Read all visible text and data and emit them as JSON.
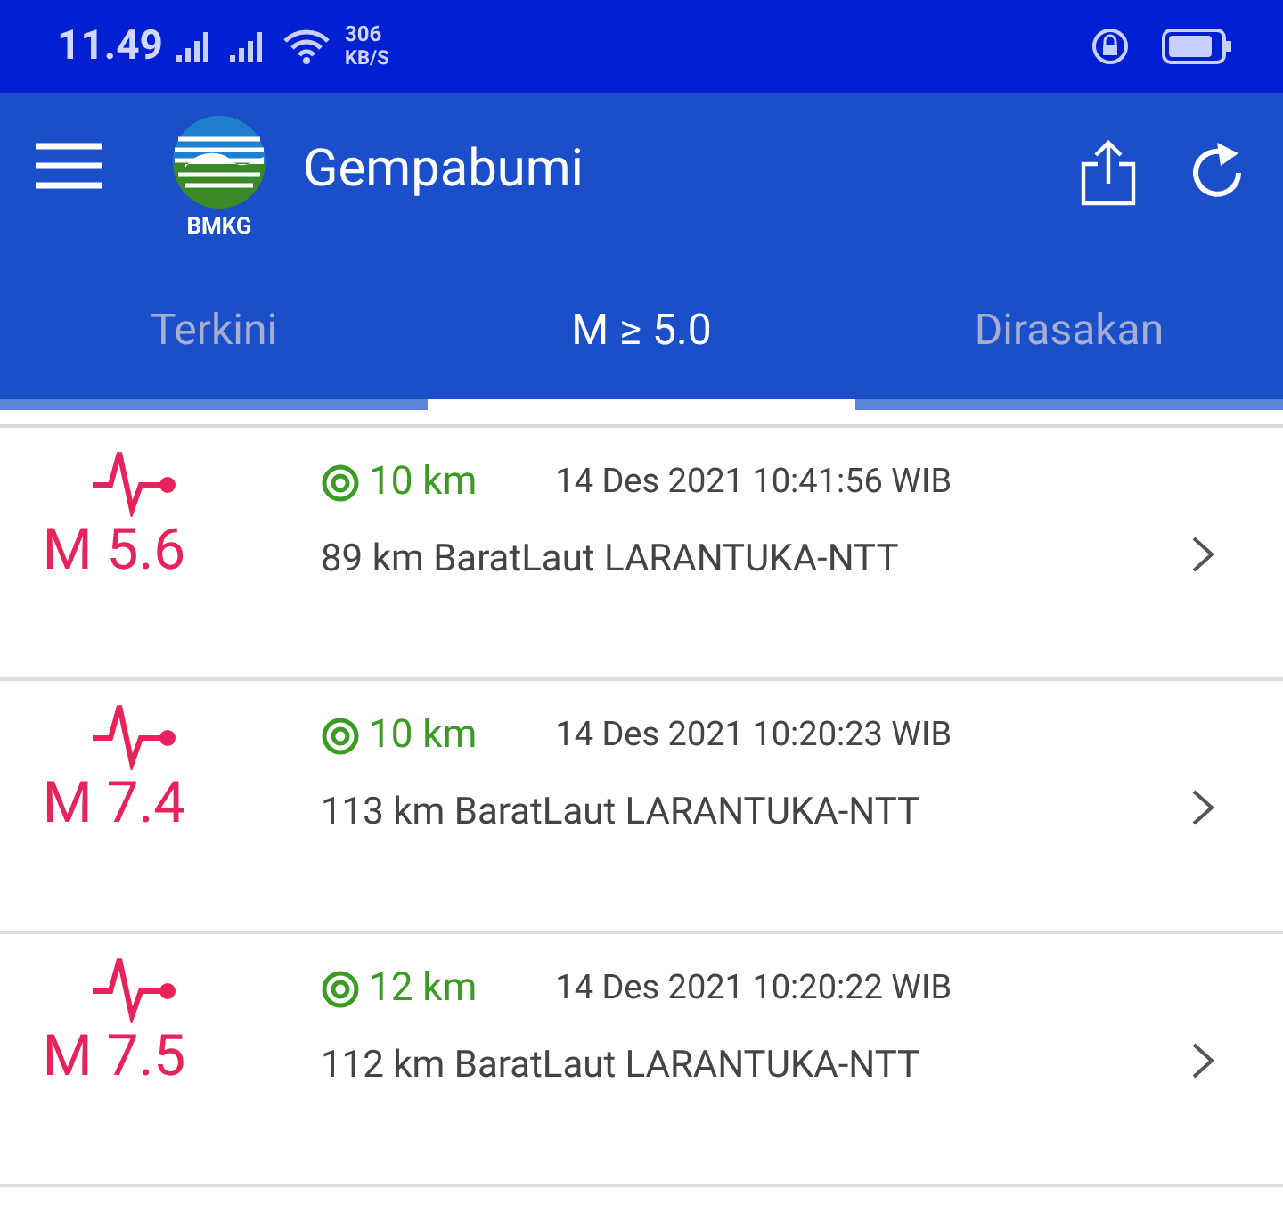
{
  "status_bar": {
    "time": "11.49",
    "speed_value": "306",
    "speed_unit": "KB/S"
  },
  "app_bar": {
    "logo_text": "BMKG",
    "title": "Gempabumi"
  },
  "tabs": [
    {
      "label": "Terkini",
      "selected": false
    },
    {
      "label": "M ≥ 5.0",
      "selected": true
    },
    {
      "label": "Dirasakan",
      "selected": false
    }
  ],
  "events": [
    {
      "magnitude": "M 5.6",
      "depth": "10 km",
      "time": "14 Des 2021 10:41:56 WIB",
      "location": "89 km BaratLaut LARANTUKA-NTT"
    },
    {
      "magnitude": "M 7.4",
      "depth": "10 km",
      "time": "14 Des 2021 10:20:23 WIB",
      "location": "113 km BaratLaut LARANTUKA-NTT"
    },
    {
      "magnitude": "M 7.5",
      "depth": "12 km",
      "time": "14 Des 2021 10:20:22 WIB",
      "location": "112 km BaratLaut LARANTUKA-NTT"
    }
  ]
}
